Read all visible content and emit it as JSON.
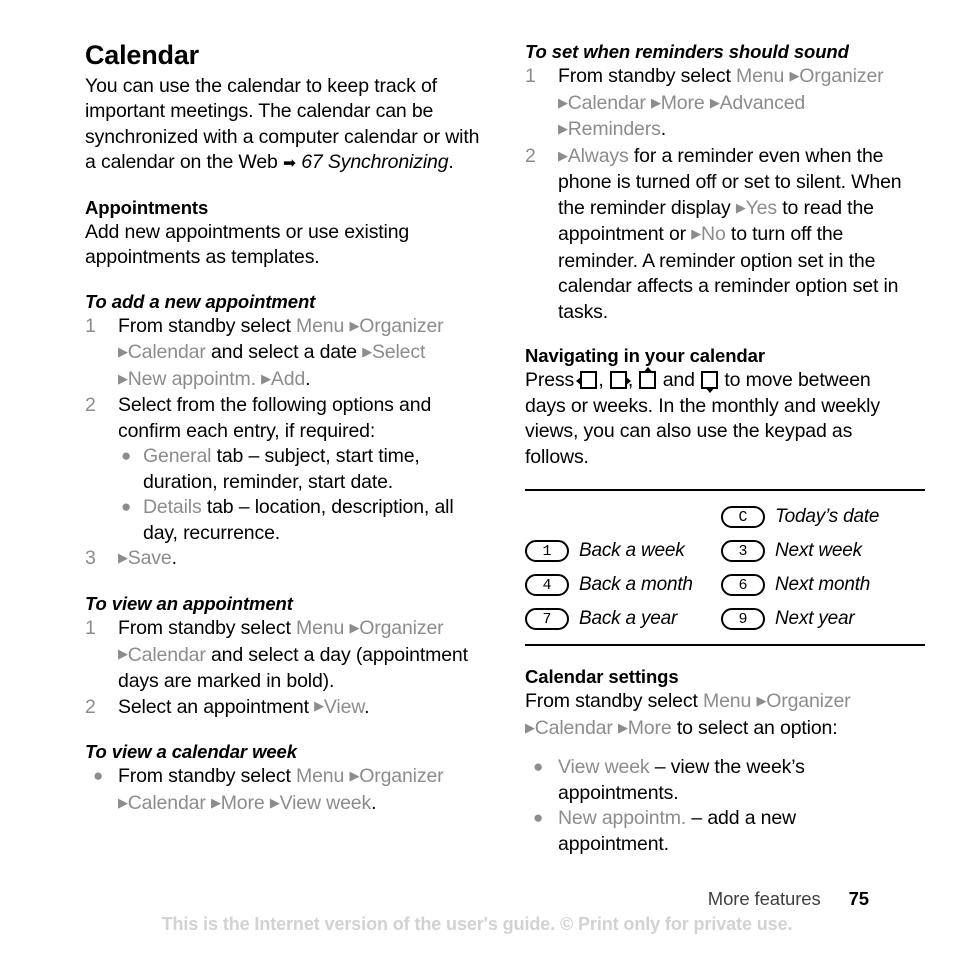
{
  "document": {
    "chapter_title": "Calendar",
    "footer_section": "More features",
    "page_number": "75",
    "disclaimer": "This is the Internet version of the user's guide. © Print only for private use."
  },
  "left_column": {
    "intro": {
      "text": "You can use the calendar to keep track of important meetings. The calendar can be synchronized with a computer calendar or with a calendar on the Web",
      "reference": "67 Synchronizing",
      "reference_suffix": "."
    },
    "appointments": {
      "heading": "Appointments",
      "text": "Add new appointments or use existing appointments as templates."
    },
    "add_appointment": {
      "heading": "To add a new appointment",
      "step1": {
        "num": "1",
        "lead": "From standby select ",
        "path": [
          "Menu",
          "Organizer",
          "Calendar"
        ],
        "mid": " and select a date ",
        "path2": [
          "Select",
          "New appointm.",
          "Add"
        ],
        "end": "."
      },
      "step2": {
        "num": "2",
        "text": "Select from the following options and confirm each entry, if required:",
        "bullets": [
          {
            "ui": "General",
            "text": " tab – subject, start time, duration, reminder, start date."
          },
          {
            "ui": "Details",
            "text": " tab – location, description, all day, recurrence."
          }
        ]
      },
      "step3": {
        "num": "3",
        "ui": "Save",
        "end": "."
      }
    },
    "view_appointment": {
      "heading": "To view an appointment",
      "step1": {
        "num": "1",
        "lead": "From standby select ",
        "path": [
          "Menu",
          "Organizer",
          "Calendar"
        ],
        "tail": " and select a day (appointment days are marked in bold)."
      },
      "step2": {
        "num": "2",
        "lead": "Select an appointment ",
        "ui": "View",
        "end": "."
      }
    },
    "view_week": {
      "heading": "To view a calendar week",
      "bullet": {
        "lead": "From standby select ",
        "path": [
          "Menu",
          "Organizer",
          "Calendar",
          "More",
          "View week"
        ],
        "end": "."
      }
    }
  },
  "right_column": {
    "reminders": {
      "heading": "To set when reminders should sound",
      "step1": {
        "num": "1",
        "lead": "From standby select ",
        "path": [
          "Menu",
          "Organizer",
          "Calendar",
          "More",
          "Advanced",
          "Reminders"
        ],
        "end": "."
      },
      "step2": {
        "num": "2",
        "ui_always": "Always",
        "text1": " for a reminder even when the phone is turned off or set to silent. When the reminder display ",
        "ui_yes": "Yes",
        "text2": " to read the appointment or ",
        "ui_no": "No",
        "text3": " to turn off the reminder. A reminder option set in the calendar affects a reminder option set in tasks."
      }
    },
    "navigating": {
      "heading": "Navigating in your calendar",
      "text_before": "Press ",
      "keys": [
        "nav-left",
        "nav-right",
        "nav-up",
        "nav-down"
      ],
      "separator1": ", ",
      "separator2": ", ",
      "separator3": " and ",
      "text_after": " to move between days or weeks. In the monthly and weekly views, you can also use the keypad as follows."
    },
    "keypad_table": {
      "rows": [
        [
          {
            "key": "",
            "label": ""
          },
          {
            "key": "C",
            "label": "Today’s date"
          }
        ],
        [
          {
            "key": "1",
            "label": "Back a week"
          },
          {
            "key": "3",
            "label": "Next week"
          }
        ],
        [
          {
            "key": "4",
            "label": "Back a month"
          },
          {
            "key": "6",
            "label": "Next month"
          }
        ],
        [
          {
            "key": "7",
            "label": "Back a year"
          },
          {
            "key": "9",
            "label": "Next year"
          }
        ]
      ]
    },
    "calendar_settings": {
      "heading": "Calendar settings",
      "lead": "From standby select ",
      "path": [
        "Menu",
        "Organizer",
        "Calendar",
        "More"
      ],
      "tail": " to select an option:",
      "options": [
        {
          "ui": "View week",
          "text": " – view the week’s appointments."
        },
        {
          "ui": "New appointm.",
          "text": " – add a new appointment."
        }
      ]
    }
  },
  "colors": {
    "ui_grey": "#8c8c8c",
    "text_black": "#000000",
    "disclaimer_grey": "#d2d2d2"
  }
}
